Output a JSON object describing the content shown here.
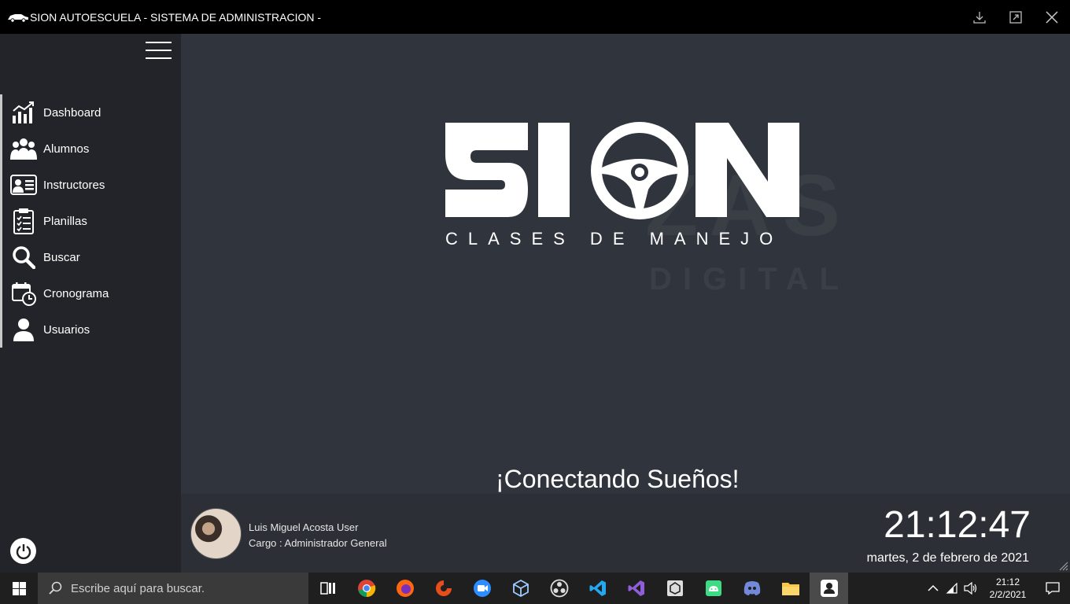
{
  "window": {
    "title": "SION AUTOESCUELA - SISTEMA DE ADMINISTRACION -"
  },
  "sidebar": {
    "items": [
      {
        "label": "Dashboard",
        "icon": "chart-icon"
      },
      {
        "label": "Alumnos",
        "icon": "group-icon"
      },
      {
        "label": "Instructores",
        "icon": "id-card-icon"
      },
      {
        "label": "Planillas",
        "icon": "clipboard-icon"
      },
      {
        "label": "Buscar",
        "icon": "search-icon"
      },
      {
        "label": "Cronograma",
        "icon": "calendar-clock-icon"
      },
      {
        "label": "Usuarios",
        "icon": "user-icon"
      }
    ]
  },
  "main": {
    "logo_tagline": "CLASES DE MANEJO",
    "slogan": "¡Conectando Sueños!"
  },
  "user": {
    "name": "Luis Miguel Acosta User",
    "role": "Cargo : Administrador General"
  },
  "clock": {
    "time": "21:12:47",
    "date": "martes, 2 de febrero de 2021"
  },
  "taskbar": {
    "search_placeholder": "Escribe aquí para buscar.",
    "tray_time": "21:12",
    "tray_date": "2/2/2021"
  },
  "colors": {
    "titlebar": "#000000",
    "sidebar": "#222429",
    "main": "#30343c",
    "accent": "#ffffff"
  }
}
